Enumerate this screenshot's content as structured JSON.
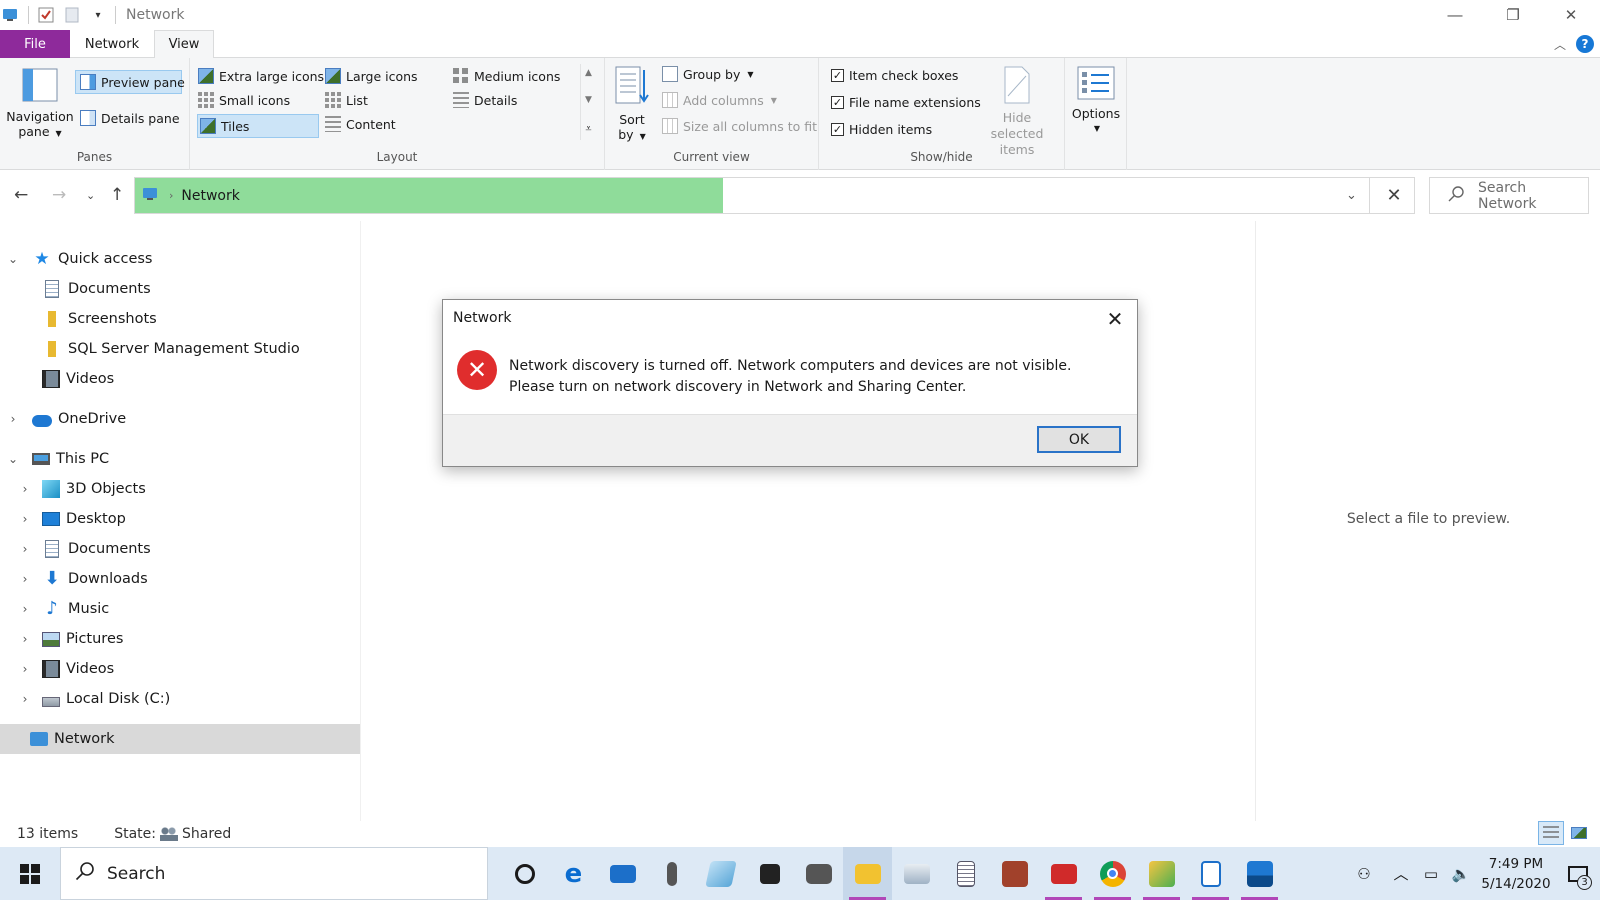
{
  "window": {
    "title": "Network"
  },
  "tabs": {
    "file": "File",
    "network": "Network",
    "view": "View"
  },
  "ribbon": {
    "panes": {
      "navigation_pane": "Navigation pane",
      "preview_pane": "Preview pane",
      "details_pane": "Details pane",
      "label": "Panes"
    },
    "layout": {
      "extra_large_icons": "Extra large icons",
      "large_icons": "Large icons",
      "medium_icons": "Medium icons",
      "small_icons": "Small icons",
      "list": "List",
      "details": "Details",
      "tiles": "Tiles",
      "content": "Content",
      "label": "Layout"
    },
    "current_view": {
      "sort_by": "Sort by",
      "group_by": "Group by",
      "add_columns": "Add columns",
      "size_all_columns": "Size all columns to fit",
      "label": "Current view"
    },
    "show_hide": {
      "item_check_boxes": "Item check boxes",
      "file_name_extensions": "File name extensions",
      "hidden_items": "Hidden items",
      "hide_selected_items": "Hide selected items",
      "label": "Show/hide"
    },
    "options": "Options"
  },
  "address": {
    "location": "Network",
    "progress": 0.46
  },
  "search": {
    "placeholder": "Search Network"
  },
  "nav_tree": {
    "quick_access": "Quick access",
    "qa_documents": "Documents",
    "qa_screenshots": "Screenshots",
    "qa_ssms": "SQL Server Management Studio",
    "qa_videos": "Videos",
    "onedrive": "OneDrive",
    "this_pc": "This PC",
    "objects_3d": "3D Objects",
    "desktop": "Desktop",
    "documents": "Documents",
    "downloads": "Downloads",
    "music": "Music",
    "pictures": "Pictures",
    "videos": "Videos",
    "local_disk": "Local Disk (C:)",
    "network": "Network"
  },
  "preview": {
    "empty_text": "Select a file to preview."
  },
  "status": {
    "item_count": "13 items",
    "state_label": "State:",
    "state_value": "Shared"
  },
  "dialog": {
    "title": "Network",
    "message": "Network discovery is turned off. Network computers and devices are not visible. Please turn on network discovery in Network and Sharing Center.",
    "ok": "OK"
  },
  "taskbar": {
    "search_placeholder": "Search",
    "time": "7:49 PM",
    "date": "5/14/2020",
    "notification_count": "3"
  },
  "colors": {
    "file_tab": "#8e2a9b",
    "address_progress": "#8fdc9a",
    "error": "#e02d2d",
    "accent": "#1778d6"
  }
}
